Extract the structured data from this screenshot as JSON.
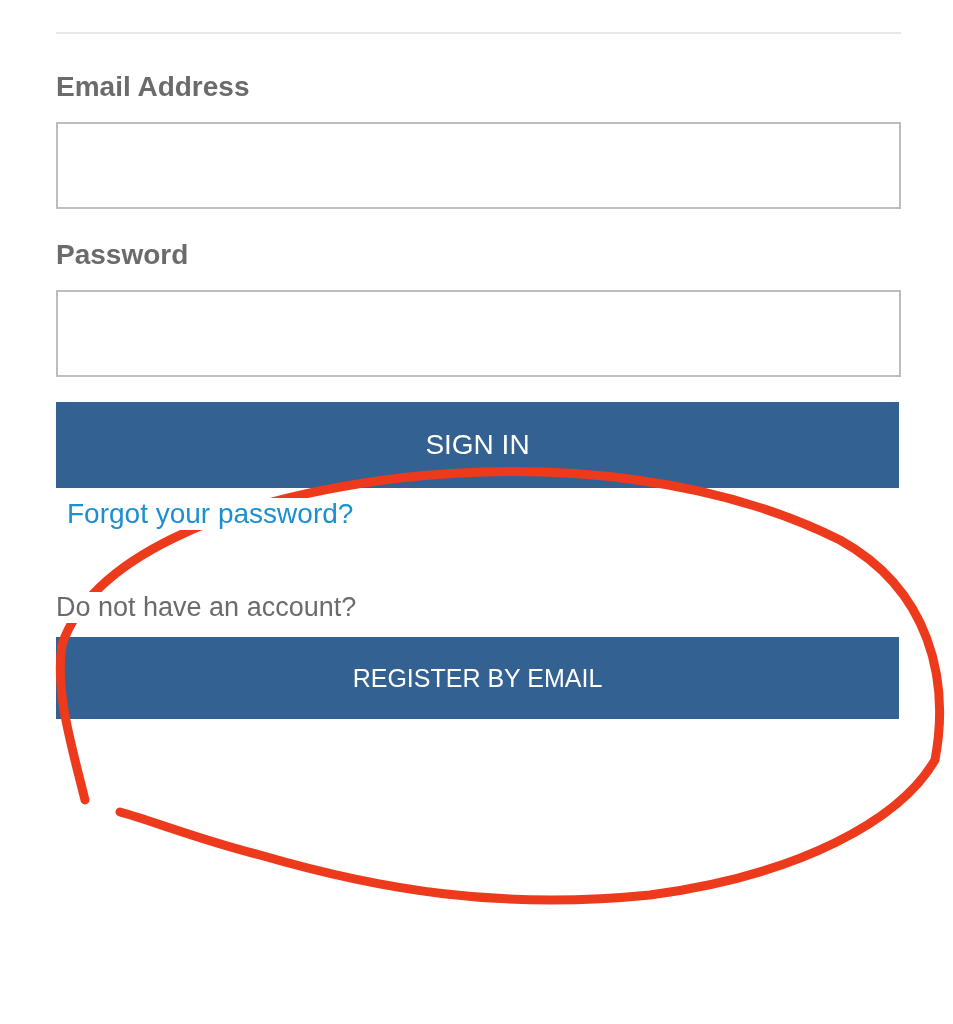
{
  "form": {
    "fields": [
      {
        "label": "Email Address"
      },
      {
        "label": "Password"
      }
    ],
    "sign_in_button": "SIGN IN",
    "forgot_link": "Forgot your password?",
    "no_account_text": "Do not have an account?",
    "register_button": "REGISTER BY EMAIL"
  }
}
